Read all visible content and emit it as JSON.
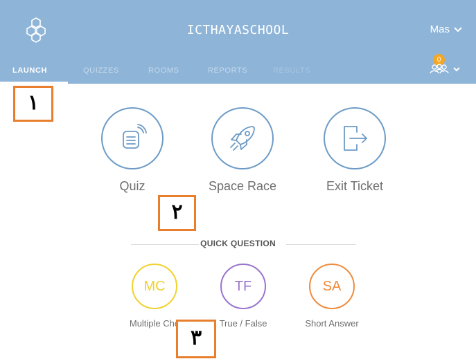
{
  "header": {
    "title": "ICTHAYASCHOOL",
    "user": "Mas",
    "student_count": "0",
    "bg_color": "#8eb4d8"
  },
  "tabs": [
    {
      "label": "LAUNCH",
      "state": "active"
    },
    {
      "label": "QUIZZES",
      "state": "normal"
    },
    {
      "label": "ROOMS",
      "state": "normal"
    },
    {
      "label": "REPORTS",
      "state": "normal"
    },
    {
      "label": "RESULTS",
      "state": "disabled"
    }
  ],
  "launch": [
    {
      "label": "Quiz",
      "icon": "quiz-icon"
    },
    {
      "label": "Space Race",
      "icon": "rocket-icon"
    },
    {
      "label": "Exit Ticket",
      "icon": "exit-icon"
    }
  ],
  "quick_question": {
    "title": "QUICK QUESTION",
    "items": [
      {
        "abbr": "MC",
        "label": "Multiple Cho",
        "color": "#f2d12e"
      },
      {
        "abbr": "TF",
        "label": "True / False",
        "color": "#9a74cf"
      },
      {
        "abbr": "SA",
        "label": "Short Answer",
        "color": "#f08b3d"
      }
    ]
  },
  "markers": [
    "١",
    "٢",
    "٣"
  ],
  "colors": {
    "accent_circle": "#6d9bc6",
    "marker_border": "#e87f2e"
  }
}
